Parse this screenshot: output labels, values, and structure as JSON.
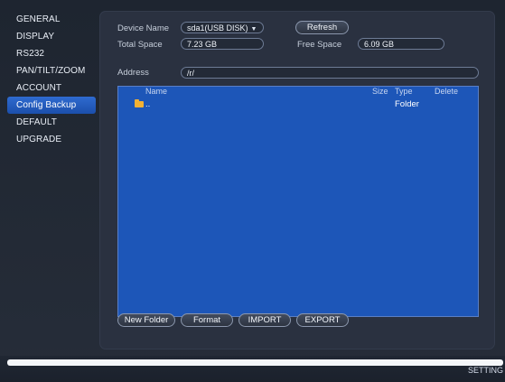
{
  "sidebar": {
    "items": [
      {
        "label": "GENERAL"
      },
      {
        "label": "DISPLAY"
      },
      {
        "label": "RS232"
      },
      {
        "label": "PAN/TILT/ZOOM"
      },
      {
        "label": "ACCOUNT"
      },
      {
        "label": "Config Backup"
      },
      {
        "label": "DEFAULT"
      },
      {
        "label": "UPGRADE"
      }
    ],
    "active_item": "Config Backup"
  },
  "device": {
    "name_label": "Device Name",
    "name_value": "sda1(USB DISK)",
    "refresh_label": "Refresh",
    "total_space_label": "Total Space",
    "total_space_value": "7.23 GB",
    "free_space_label": "Free Space",
    "free_space_value": "6.09 GB",
    "address_label": "Address",
    "address_value": "/r/"
  },
  "file_list": {
    "columns": [
      "Name",
      "Size",
      "Type",
      "Delete"
    ],
    "rows": [
      {
        "name": "..",
        "size": "",
        "type": "Folder",
        "icon": "folder-icon"
      }
    ]
  },
  "actions": {
    "new_folder": "New Folder",
    "format": "Format",
    "import": "IMPORT",
    "export": "EXPORT"
  },
  "footer": {
    "tab_label": "SETTING"
  },
  "colors": {
    "accent": "#1d56b8",
    "active_menu": "#2f6bd0",
    "folder": "#f2b134"
  }
}
